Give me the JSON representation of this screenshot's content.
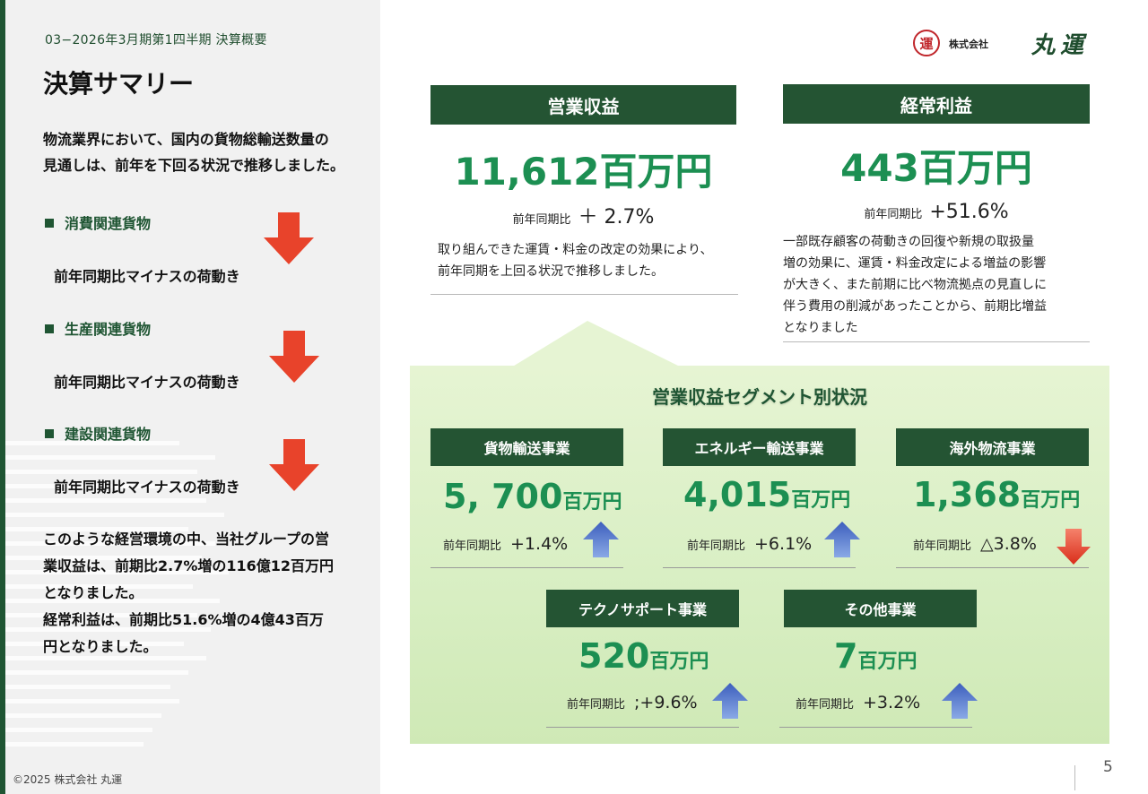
{
  "header": {
    "section_label": "03−2026年3月期第1四半期 決算概要",
    "page_title": "決算サマリー",
    "logo": {
      "mark": "運",
      "small": "株式会社",
      "name": "丸運"
    }
  },
  "left": {
    "lead": [
      "物流業界において、国内の貨物総輸送数量の",
      "見通しは、前年を下回る状況で推移しました。"
    ],
    "categories": [
      {
        "label": "消費関連貨物",
        "status": "前年同期比マイナスの荷動き",
        "trend": "down"
      },
      {
        "label": "生産関連貨物",
        "status": "前年同期比マイナスの荷動き",
        "trend": "down"
      },
      {
        "label": "建設関連貨物",
        "status": "前年同期比マイナスの荷動き",
        "trend": "down"
      }
    ],
    "summary": [
      "このような経営環境の中、当社グループの営",
      "業収益は、前期比2.7%増の116億12百万円",
      "となりました。",
      "経常利益は、前期比51.6%増の4億43百万",
      "円となりました。"
    ]
  },
  "kpis": [
    {
      "title": "営業収益",
      "value": "11,612百万円",
      "yoy_label": "前年同期比",
      "yoy_value": "＋ 2.7%",
      "desc": [
        "取り組んできた運賃・料金の改定の効果により、",
        "前年同期を上回る状況で推移しました。"
      ]
    },
    {
      "title": "経常利益",
      "value": "443百万円",
      "yoy_label": "前年同期比",
      "yoy_value": "+51.6%",
      "desc": [
        "一部既存顧客の荷動きの回復や新規の取扱量",
        "増の効果に、運賃・料金改定による増益の影響",
        "が大きく、また前期に比べ物流拠点の見直しに",
        "伴う費用の削減があったことから、前期比増益",
        "となりました"
      ]
    }
  ],
  "segments": {
    "title": "営業収益セグメント別状況",
    "items": [
      {
        "name": "貨物輸送事業",
        "value": "5, 700",
        "unit": "百万円",
        "yoy_label": "前年同期比",
        "yoy_value": "+1.4%",
        "trend": "up"
      },
      {
        "name": "エネルギー輸送事業",
        "value": "4,015",
        "unit": "百万円",
        "yoy_label": "前年同期比",
        "yoy_value": "+6.1%",
        "trend": "up"
      },
      {
        "name": "海外物流事業",
        "value": "1,368",
        "unit": "百万円",
        "yoy_label": "前年同期比",
        "yoy_value": "△3.8%",
        "trend": "down"
      },
      {
        "name": "テクノサポート事業",
        "value": "520",
        "unit": "百万円",
        "yoy_label": "前年同期比",
        "yoy_value": ";+9.6%",
        "trend": "up"
      },
      {
        "name": "その他事業",
        "value": "7",
        "unit": "百万円",
        "yoy_label": "前年同期比",
        "yoy_value": "+3.2%",
        "trend": "up"
      }
    ]
  },
  "footer": {
    "copyright": "©2025  株式会社 丸運",
    "page_number": "5"
  },
  "colors": {
    "brand_green": "#245433",
    "value_green": "#1c8f52",
    "down_red": "#e8432b",
    "up_blue": "#4a6fc4",
    "logo_red": "#c0262b"
  }
}
